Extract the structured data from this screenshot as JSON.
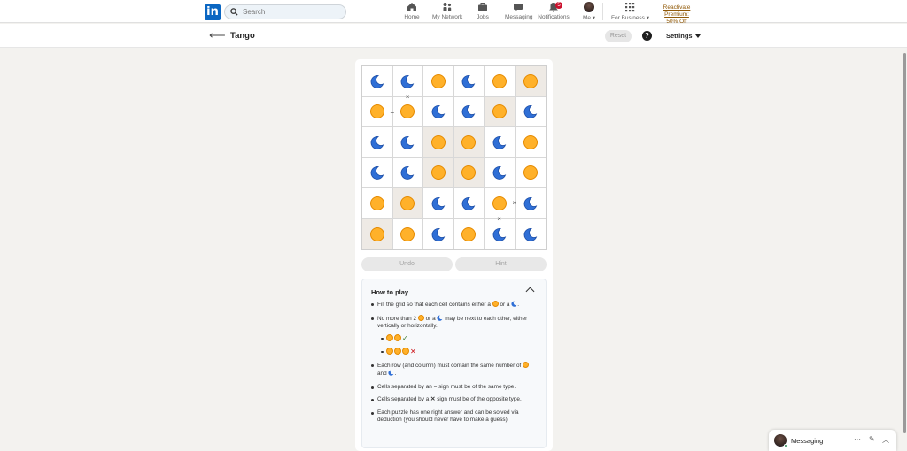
{
  "nav": {
    "search_placeholder": "Search",
    "items": [
      {
        "label": "Home",
        "icon": "home-icon"
      },
      {
        "label": "My Network",
        "icon": "network-icon"
      },
      {
        "label": "Jobs",
        "icon": "jobs-icon"
      },
      {
        "label": "Messaging",
        "icon": "messaging-icon"
      },
      {
        "label": "Notifications",
        "icon": "bell-icon",
        "badge": "5"
      },
      {
        "label": "Me",
        "icon": "avatar"
      },
      {
        "label": "For Business",
        "icon": "grid-icon"
      }
    ],
    "premium_line1": "Reactivate Premium:",
    "premium_line2": "50% Off",
    "brand_color": "#0a66c2"
  },
  "header": {
    "title": "Tango",
    "reset_label": "Reset",
    "help_label": "?",
    "settings_label": "Settings"
  },
  "game": {
    "board": [
      [
        "moon",
        "moon",
        "sun",
        "moon",
        "sun",
        "sun"
      ],
      [
        "sun",
        "sun",
        "moon",
        "moon",
        "sun",
        "moon"
      ],
      [
        "moon",
        "moon",
        "sun",
        "sun",
        "moon",
        "sun"
      ],
      [
        "moon",
        "moon",
        "sun",
        "sun",
        "moon",
        "sun"
      ],
      [
        "sun",
        "sun",
        "moon",
        "moon",
        "sun",
        "moon"
      ],
      [
        "sun",
        "sun",
        "moon",
        "sun",
        "moon",
        "moon"
      ]
    ],
    "locked": [
      [
        0,
        5
      ],
      [
        1,
        4
      ],
      [
        2,
        2
      ],
      [
        2,
        3
      ],
      [
        3,
        2
      ],
      [
        3,
        3
      ],
      [
        4,
        1
      ],
      [
        5,
        0
      ]
    ],
    "constraints": [
      {
        "type": "×",
        "between": [
          [
            0,
            1
          ],
          [
            1,
            1
          ]
        ]
      },
      {
        "type": "=",
        "between": [
          [
            1,
            0
          ],
          [
            1,
            1
          ]
        ]
      },
      {
        "type": "×",
        "between": [
          [
            4,
            4
          ],
          [
            4,
            5
          ]
        ]
      },
      {
        "type": "×",
        "between": [
          [
            4,
            4
          ],
          [
            5,
            4
          ]
        ]
      }
    ],
    "undo_label": "Undo",
    "hint_label": "Hint",
    "sun_color": "#ffb12a",
    "moon_color": "#2f6fd6"
  },
  "howto": {
    "title": "How to play",
    "r1a": "Fill the grid so that each cell contains either a",
    "or": "or a",
    "r2a": "No more than 2",
    "r2b": "may be next to each other, either vertically or horizontally.",
    "check": "✓",
    "cross": "✕",
    "r3a": "Each row (and column) must contain the same number of",
    "and": "and",
    "r4": "Cells separated by an = sign must be of the same type.",
    "r5a": "Cells separated by a",
    "r5x": "✕",
    "r5b": "sign must be of the opposite type.",
    "r6": "Each puzzle has one right answer and can be solved via deduction (you should never have to make a guess)."
  },
  "messaging": {
    "label": "Messaging",
    "more": "···",
    "compose_icon": "compose-icon",
    "collapse_icon": "chevron-up-icon"
  }
}
